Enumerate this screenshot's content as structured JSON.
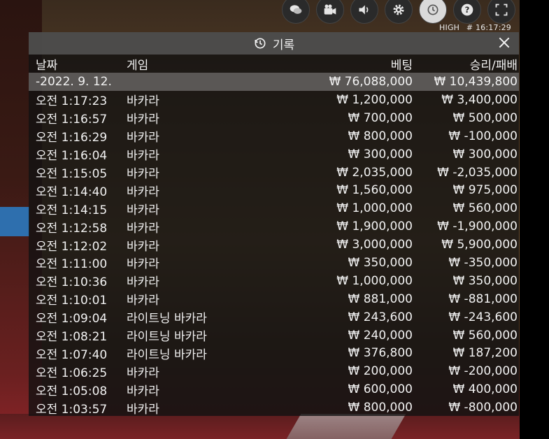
{
  "hud": {
    "quality": "HIGH",
    "game_id": "# 16:17:29"
  },
  "icons": [
    "chat-icon",
    "camera-icon",
    "speaker-icon",
    "gear-icon",
    "history-icon",
    "help-icon",
    "fullscreen-icon"
  ],
  "panel": {
    "title": "기록",
    "headers": {
      "date": "날짜",
      "game": "게임",
      "bet": "베팅",
      "result": "승리/패배"
    },
    "summary": {
      "date": "-2022. 9. 12.",
      "bet": "₩ 76,088,000",
      "result": "₩ 10,439,800"
    },
    "rows": [
      {
        "time": "오전 1:17:23",
        "game": "바카라",
        "bet": "₩ 1,200,000",
        "result": "₩ 3,400,000"
      },
      {
        "time": "오전 1:16:57",
        "game": "바카라",
        "bet": "₩ 700,000",
        "result": "₩ 500,000"
      },
      {
        "time": "오전 1:16:29",
        "game": "바카라",
        "bet": "₩ 800,000",
        "result": "₩ -100,000"
      },
      {
        "time": "오전 1:16:04",
        "game": "바카라",
        "bet": "₩ 300,000",
        "result": "₩ 300,000"
      },
      {
        "time": "오전 1:15:05",
        "game": "바카라",
        "bet": "₩ 2,035,000",
        "result": "₩ -2,035,000"
      },
      {
        "time": "오전 1:14:40",
        "game": "바카라",
        "bet": "₩ 1,560,000",
        "result": "₩ 975,000"
      },
      {
        "time": "오전 1:14:15",
        "game": "바카라",
        "bet": "₩ 1,000,000",
        "result": "₩ 560,000"
      },
      {
        "time": "오전 1:12:58",
        "game": "바카라",
        "bet": "₩ 1,900,000",
        "result": "₩ -1,900,000"
      },
      {
        "time": "오전 1:12:02",
        "game": "바카라",
        "bet": "₩ 3,000,000",
        "result": "₩ 5,900,000"
      },
      {
        "time": "오전 1:11:00",
        "game": "바카라",
        "bet": "₩ 350,000",
        "result": "₩ -350,000"
      },
      {
        "time": "오전 1:10:36",
        "game": "바카라",
        "bet": "₩ 1,000,000",
        "result": "₩ 350,000"
      },
      {
        "time": "오전 1:10:01",
        "game": "바카라",
        "bet": "₩ 881,000",
        "result": "₩ -881,000"
      },
      {
        "time": "오전 1:09:04",
        "game": "라이트닝 바카라",
        "bet": "₩ 243,600",
        "result": "₩ -243,600"
      },
      {
        "time": "오전 1:08:21",
        "game": "라이트닝 바카라",
        "bet": "₩ 240,000",
        "result": "₩ 560,000"
      },
      {
        "time": "오전 1:07:40",
        "game": "라이트닝 바카라",
        "bet": "₩ 376,800",
        "result": "₩ 187,200"
      },
      {
        "time": "오전 1:06:25",
        "game": "바카라",
        "bet": "₩ 200,000",
        "result": "₩ -200,000"
      },
      {
        "time": "오전 1:05:08",
        "game": "바카라",
        "bet": "₩ 600,000",
        "result": "₩ 400,000"
      },
      {
        "time": "오전 1:03:57",
        "game": "바카라",
        "bet": "₩ 800,000",
        "result": "₩ -800,000"
      }
    ]
  }
}
